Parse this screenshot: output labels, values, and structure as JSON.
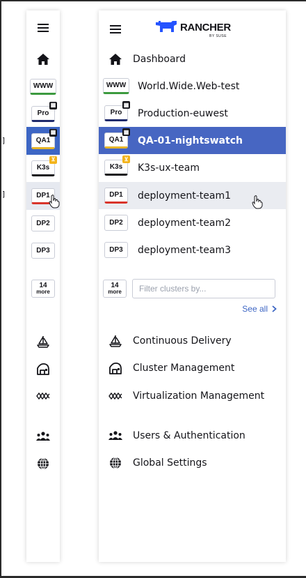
{
  "brand": {
    "logo_text": "RANCHER",
    "logo_sub": "BY SUSE",
    "accent": "#3d66c4"
  },
  "rail_markers": [
    "]",
    "]"
  ],
  "dashboard": {
    "label": "Dashboard",
    "icon": "home-icon"
  },
  "clusters": [
    {
      "badge": "WWW",
      "name": "World.Wide.Web-test",
      "bar_color": "#3c9a3f",
      "corner": ""
    },
    {
      "badge": "Pro",
      "name": "Production-euwest",
      "bar_color": "#1f2a6b",
      "corner": "cluster-type-icon"
    },
    {
      "badge": "QA1",
      "name": "QA-01-nightswatch",
      "bar_color": "#e6b529",
      "corner": "cluster-type-icon",
      "selected": true
    },
    {
      "badge": "K3s",
      "name": "K3s-ux-team",
      "bar_color": "#141419",
      "corner": "k3s-icon"
    },
    {
      "badge": "DP1",
      "name": "deployment-team1",
      "bar_color": "#d9342b",
      "corner": "",
      "hovered": true
    },
    {
      "badge": "DP2",
      "name": "deployment-team2",
      "bar_color": "",
      "corner": ""
    },
    {
      "badge": "DP3",
      "name": "deployment-team3",
      "bar_color": "",
      "corner": ""
    }
  ],
  "more": {
    "count": "14",
    "label": "more"
  },
  "filter": {
    "placeholder": "Filter clusters by..."
  },
  "see_all": {
    "label": "See all"
  },
  "menu": [
    {
      "label": "Continuous Delivery",
      "icon": "sailboat-icon"
    },
    {
      "label": "Cluster Management",
      "icon": "cluster-management-icon"
    },
    {
      "label": "Virtualization Management",
      "icon": "virtualization-icon"
    },
    {
      "label": "Users & Authentication",
      "icon": "users-icon"
    },
    {
      "label": "Global Settings",
      "icon": "globe-icon"
    }
  ]
}
